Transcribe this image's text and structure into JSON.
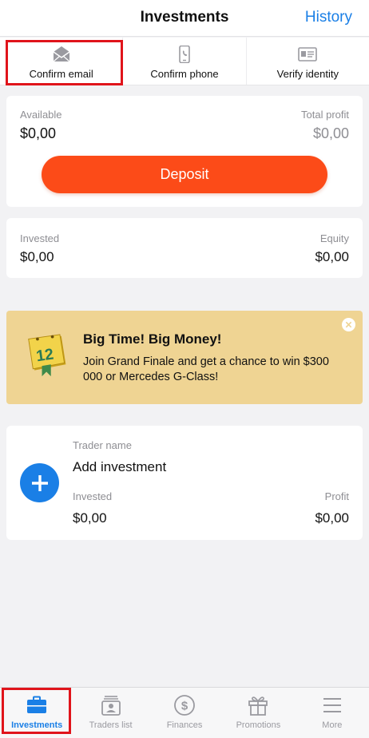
{
  "header": {
    "title": "Investments",
    "history_label": "History"
  },
  "verification": [
    {
      "label": "Confirm email",
      "icon": "envelope-icon"
    },
    {
      "label": "Confirm phone",
      "icon": "phone-icon"
    },
    {
      "label": "Verify identity",
      "icon": "id-card-icon"
    }
  ],
  "balance": {
    "available_label": "Available",
    "available_value": "$0,00",
    "total_profit_label": "Total profit",
    "total_profit_value": "$0,00",
    "deposit_label": "Deposit"
  },
  "summary": {
    "invested_label": "Invested",
    "invested_value": "$0,00",
    "equity_label": "Equity",
    "equity_value": "$0,00"
  },
  "promo": {
    "title": "Big Time! Big Money!",
    "text": "Join Grand Finale and get a chance to win $300 000 or Mercedes G-Class!",
    "badge_number": "12"
  },
  "investment": {
    "trader_label": "Trader name",
    "add_label": "Add investment",
    "invested_label": "Invested",
    "invested_value": "$0,00",
    "profit_label": "Profit",
    "profit_value": "$0,00"
  },
  "tabs": [
    {
      "label": "Investments",
      "icon": "briefcase-icon",
      "active": true
    },
    {
      "label": "Traders list",
      "icon": "trader-icon",
      "active": false
    },
    {
      "label": "Finances",
      "icon": "dollar-icon",
      "active": false
    },
    {
      "label": "Promotions",
      "icon": "gift-icon",
      "active": false
    },
    {
      "label": "More",
      "icon": "menu-icon",
      "active": false
    }
  ],
  "colors": {
    "accent": "#1a7fe6",
    "deposit": "#fc4b18",
    "promo_bg": "#efd493",
    "highlight": "#e0141b"
  }
}
